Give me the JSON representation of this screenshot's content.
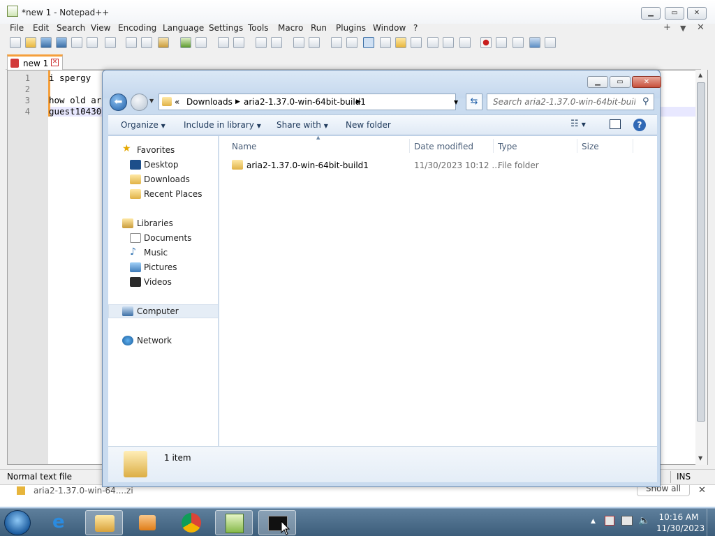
{
  "npp": {
    "title": "*new 1 - Notepad++",
    "menu": [
      "File",
      "Edit",
      "Search",
      "View",
      "Encoding",
      "Language",
      "Settings",
      "Tools",
      "Macro",
      "Run",
      "Plugins",
      "Window",
      "?"
    ],
    "menu_right": [
      "+",
      "▼",
      "✕"
    ],
    "tab": "new 1",
    "lines": [
      {
        "n": "1",
        "text": "i spergy"
      },
      {
        "n": "2",
        "text": ""
      },
      {
        "n": "3",
        "text": "how old ar"
      },
      {
        "n": "4",
        "text": "guest10430"
      }
    ],
    "status_left": "Normal text file",
    "status_right": "INS"
  },
  "download_bar": {
    "item": "aria2-1.37.0-win-64....zi",
    "show_all": "Show all",
    "close": "✕"
  },
  "explorer": {
    "address": [
      "«",
      "Downloads",
      "aria2-1.37.0-win-64bit-build1"
    ],
    "search_placeholder": "Search aria2-1.37.0-win-64bit-build1",
    "commands": {
      "organize": "Organize",
      "include": "Include in library",
      "share": "Share with",
      "new_folder": "New folder"
    },
    "nav": {
      "favorites": "Favorites",
      "desktop": "Desktop",
      "downloads": "Downloads",
      "recent": "Recent Places",
      "libraries": "Libraries",
      "documents": "Documents",
      "music": "Music",
      "pictures": "Pictures",
      "videos": "Videos",
      "computer": "Computer",
      "network": "Network"
    },
    "columns": [
      "Name",
      "Date modified",
      "Type",
      "Size"
    ],
    "files": [
      {
        "name": "aria2-1.37.0-win-64bit-build1",
        "date": "11/30/2023 10:12 ...",
        "type": "File folder",
        "size": ""
      }
    ],
    "item_count": "1 item"
  },
  "taskbar": {
    "time": "10:16 AM",
    "date": "11/30/2023"
  }
}
